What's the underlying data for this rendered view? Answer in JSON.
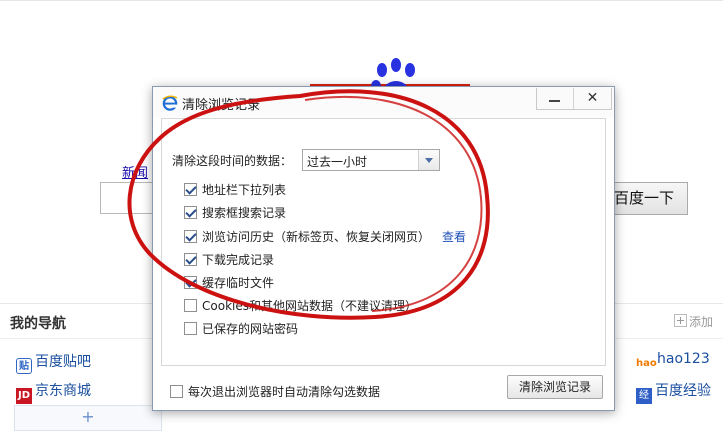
{
  "background_page": {
    "logo_alt": "Baidu",
    "news_link": "新闻",
    "search_button": "百度一下",
    "nav": {
      "title": "我的导航",
      "add_label": "添加",
      "sites": [
        {
          "label": "百度贴吧",
          "icon": "tieba-icon",
          "icon_text": "贴"
        },
        {
          "label": "京东商城",
          "icon": "jd-icon",
          "icon_text": "JD"
        },
        {
          "label": "hao123",
          "icon": "hao123-icon",
          "icon_text": "hao"
        },
        {
          "label": "百度经验",
          "icon": "baidu-jingyan-icon",
          "icon_text": "经"
        }
      ],
      "add_row_symbol": "+"
    }
  },
  "dialog": {
    "title": "清除浏览记录",
    "title_icon": "ie-e-icon",
    "close_symbol": "✕",
    "range_label": "清除这段时间的数据：",
    "range_value": "过去一小时",
    "options": [
      {
        "label": "地址栏下拉列表",
        "checked": true
      },
      {
        "label": "搜索框搜索记录",
        "checked": true
      },
      {
        "label": "浏览访问历史（新标签页、恢复关闭网页）",
        "checked": true,
        "link": "查看"
      },
      {
        "label": "下载完成记录",
        "checked": true
      },
      {
        "label": "缓存临时文件",
        "checked": true
      },
      {
        "label": "Cookies和其他网站数据（不建议清理）",
        "checked": false
      },
      {
        "label": "已保存的网站密码",
        "checked": false
      }
    ],
    "auto_clear_label": "每次退出浏览器时自动清除勾选数据",
    "auto_clear_checked": false,
    "clear_button": "清除浏览记录"
  },
  "colors": {
    "annotation_red": "#cc1111",
    "link_blue": "#1a4fa0",
    "dialog_border": "#8a9ab3"
  }
}
